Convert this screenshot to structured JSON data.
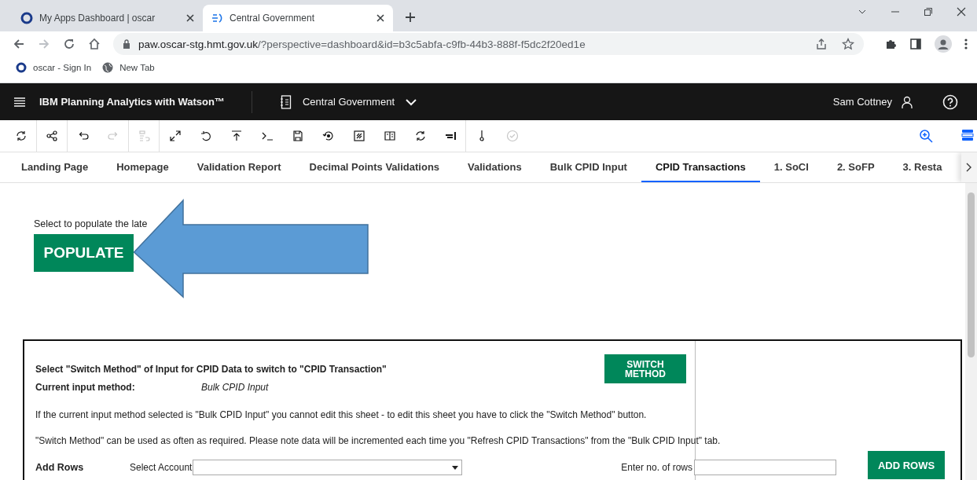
{
  "browser": {
    "tabs": [
      {
        "title": "My Apps Dashboard | oscar",
        "selected": false
      },
      {
        "title": "Central Government",
        "selected": true
      }
    ],
    "url_host": "paw.oscar-stg.hmt.gov.uk",
    "url_path": "/?perspective=dashboard&id=b3c5abfa-c9fb-44b3-888f-f5dc2f20ed1e",
    "bookmarks": [
      {
        "label": "oscar - Sign In",
        "kind": "oscar"
      },
      {
        "label": "New Tab",
        "kind": "globe"
      }
    ]
  },
  "app": {
    "title": "IBM Planning Analytics with Watson™",
    "workbook": "Central Government",
    "user": "Sam Cottney"
  },
  "toolbar": [
    {
      "kind": "refresh",
      "disabled": false
    },
    {
      "kind": "share",
      "disabled": false
    },
    {
      "kind": "undo",
      "disabled": false
    },
    {
      "kind": "redo",
      "disabled": true
    },
    {
      "kind": "list-undo",
      "disabled": true
    },
    {
      "kind": "expand",
      "disabled": false
    },
    {
      "kind": "reset",
      "disabled": false
    },
    {
      "kind": "upload",
      "disabled": false
    },
    {
      "kind": "terminal",
      "disabled": false
    },
    {
      "kind": "save",
      "disabled": false
    },
    {
      "kind": "restore",
      "disabled": false
    },
    {
      "kind": "snapshot",
      "disabled": false
    },
    {
      "kind": "sheet",
      "disabled": false
    },
    {
      "kind": "sync",
      "disabled": false
    },
    {
      "kind": "align",
      "disabled": false
    },
    {
      "kind": "pin",
      "disabled": false
    },
    {
      "kind": "check",
      "disabled": true
    }
  ],
  "sheet_tabs": [
    {
      "label": "Landing Page",
      "selected": false
    },
    {
      "label": "Homepage",
      "selected": false
    },
    {
      "label": "Validation Report",
      "selected": false
    },
    {
      "label": "Decimal Points Validations",
      "selected": false
    },
    {
      "label": "Validations",
      "selected": false
    },
    {
      "label": "Bulk CPID Input",
      "selected": false
    },
    {
      "label": "CPID Transactions",
      "selected": true
    },
    {
      "label": "1. SoCI",
      "selected": false
    },
    {
      "label": "2. SoFP",
      "selected": false
    },
    {
      "label": "3. Resta",
      "selected": false
    }
  ],
  "content": {
    "populate_hint": "Select to populate the late",
    "populate_button": "POPULATE",
    "panel": {
      "heading": "Select \"Switch Method\" of Input for CPID Data to switch to \"CPID Transaction\"",
      "method_label": "Current input method:",
      "method_value": "Bulk CPID Input",
      "switch_button": "SWITCH METHOD",
      "notes": [
        "If the current input method selected is \"Bulk CPID Input\" you cannot edit this sheet - to edit this sheet you have to click the \"Switch Method\" button.",
        "\"Switch Method\" can be used as often as required. Please note data will be incremented each time you \"Refresh CPID Transactions\" from the \"Bulk CPID Input\" tab."
      ],
      "add_rows_label": "Add Rows",
      "account_label": "Select Account",
      "rows_label": "Enter no. of rows",
      "add_button": "ADD ROWS"
    }
  }
}
